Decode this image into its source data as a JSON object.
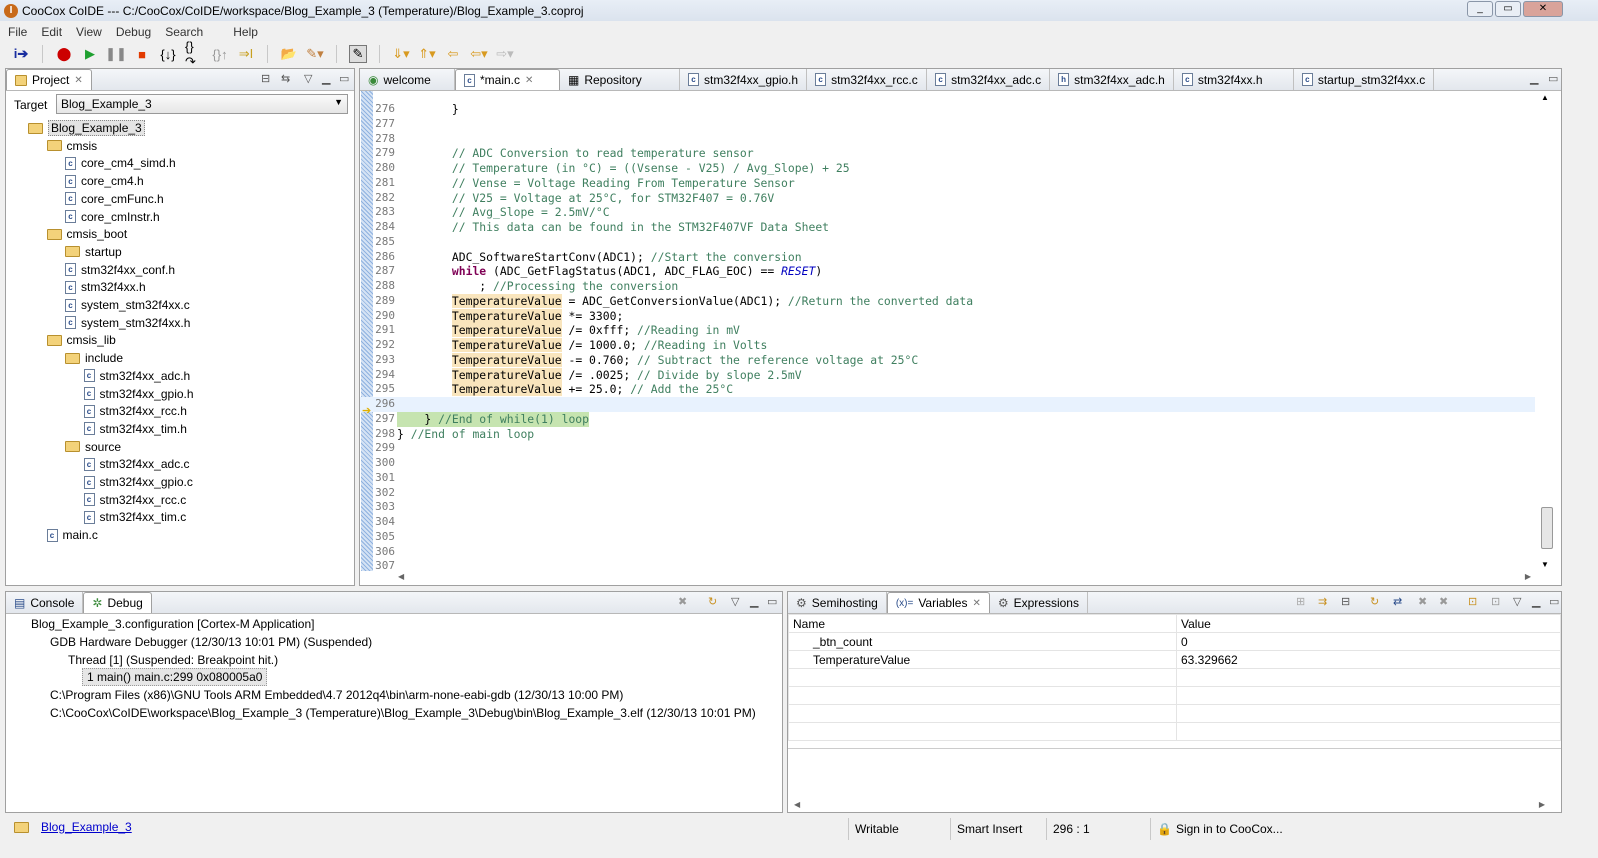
{
  "window": {
    "title": "CooCox CoIDE --- C:/CooCox/CoIDE/workspace/Blog_Example_3 (Temperature)/Blog_Example_3.coproj",
    "app_icon": "I"
  },
  "menu": [
    "File",
    "Edit",
    "View",
    "Debug",
    "Search",
    "Help"
  ],
  "project": {
    "tab_label": "Project",
    "target_label": "Target",
    "target_value": "Blog_Example_3",
    "tree": [
      {
        "label": "Blog_Example_3",
        "level": 0,
        "type": "project"
      },
      {
        "label": "cmsis",
        "level": 1,
        "type": "folder"
      },
      {
        "label": "core_cm4_simd.h",
        "level": 2,
        "type": "file"
      },
      {
        "label": "core_cm4.h",
        "level": 2,
        "type": "file"
      },
      {
        "label": "core_cmFunc.h",
        "level": 2,
        "type": "file"
      },
      {
        "label": "core_cmInstr.h",
        "level": 2,
        "type": "file"
      },
      {
        "label": "cmsis_boot",
        "level": 1,
        "type": "folder"
      },
      {
        "label": "startup",
        "level": 2,
        "type": "folder"
      },
      {
        "label": "stm32f4xx_conf.h",
        "level": 2,
        "type": "file"
      },
      {
        "label": "stm32f4xx.h",
        "level": 2,
        "type": "file"
      },
      {
        "label": "system_stm32f4xx.c",
        "level": 2,
        "type": "file"
      },
      {
        "label": "system_stm32f4xx.h",
        "level": 2,
        "type": "file"
      },
      {
        "label": "cmsis_lib",
        "level": 1,
        "type": "folder"
      },
      {
        "label": "include",
        "level": 2,
        "type": "folder"
      },
      {
        "label": "stm32f4xx_adc.h",
        "level": 3,
        "type": "file"
      },
      {
        "label": "stm32f4xx_gpio.h",
        "level": 3,
        "type": "file"
      },
      {
        "label": "stm32f4xx_rcc.h",
        "level": 3,
        "type": "file"
      },
      {
        "label": "stm32f4xx_tim.h",
        "level": 3,
        "type": "file"
      },
      {
        "label": "source",
        "level": 2,
        "type": "folder"
      },
      {
        "label": "stm32f4xx_adc.c",
        "level": 3,
        "type": "file"
      },
      {
        "label": "stm32f4xx_gpio.c",
        "level": 3,
        "type": "file"
      },
      {
        "label": "stm32f4xx_rcc.c",
        "level": 3,
        "type": "file"
      },
      {
        "label": "stm32f4xx_tim.c",
        "level": 3,
        "type": "file"
      },
      {
        "label": "main.c",
        "level": 1,
        "type": "file"
      }
    ]
  },
  "editor": {
    "tabs": [
      {
        "label": "welcome",
        "icon": "globe"
      },
      {
        "label": "*main.c",
        "icon": "c",
        "active": true
      },
      {
        "label": "Repository",
        "icon": "grid"
      },
      {
        "label": "stm32f4xx_gpio.h",
        "icon": "c"
      },
      {
        "label": "stm32f4xx_rcc.c",
        "icon": "c"
      },
      {
        "label": "stm32f4xx_adc.c",
        "icon": "c"
      },
      {
        "label": "stm32f4xx_adc.h",
        "icon": "h"
      },
      {
        "label": "stm32f4xx.h",
        "icon": "c"
      },
      {
        "label": "startup_stm32f4xx.c",
        "icon": "c"
      }
    ],
    "lines": [
      {
        "n": "276",
        "s": [
          [
            "        }",
            ""
          ]
        ]
      },
      {
        "n": "277",
        "s": []
      },
      {
        "n": "278",
        "s": []
      },
      {
        "n": "279",
        "s": [
          [
            "        // ADC Conversion to read temperature sensor",
            "cm"
          ]
        ]
      },
      {
        "n": "280",
        "s": [
          [
            "        // Temperature (in °C) = ((Vsense - V25) / Avg_Slope) + 25",
            "cm"
          ]
        ]
      },
      {
        "n": "281",
        "s": [
          [
            "        // Vense = Voltage Reading From Temperature Sensor",
            "cm"
          ]
        ]
      },
      {
        "n": "282",
        "s": [
          [
            "        // V25 = Voltage at 25°C, for STM32F407 = 0.76V",
            "cm"
          ]
        ]
      },
      {
        "n": "283",
        "s": [
          [
            "        // Avg_Slope = 2.5mV/°C",
            "cm"
          ]
        ]
      },
      {
        "n": "284",
        "s": [
          [
            "        // This data can be found in the STM32F407VF Data Sheet",
            "cm"
          ]
        ]
      },
      {
        "n": "285",
        "s": []
      },
      {
        "n": "286",
        "s": [
          [
            "        ADC_SoftwareStartConv(ADC1); ",
            ""
          ],
          [
            "//Start the conversion",
            "cm"
          ]
        ]
      },
      {
        "n": "287",
        "s": [
          [
            "        ",
            ""
          ],
          [
            "while",
            "kw"
          ],
          [
            " (ADC_GetFlagStatus(ADC1, ADC_FLAG_EOC) == ",
            ""
          ],
          [
            "RESET",
            "en"
          ],
          [
            ")",
            ""
          ]
        ]
      },
      {
        "n": "288",
        "s": [
          [
            "            ; ",
            ""
          ],
          [
            "//Processing the conversion",
            "cm"
          ]
        ]
      },
      {
        "n": "289",
        "s": [
          [
            "        ",
            ""
          ],
          [
            "TemperatureValue",
            "hl"
          ],
          [
            " = ADC_GetConversionValue(ADC1); ",
            ""
          ],
          [
            "//Return the converted data",
            "cm"
          ]
        ]
      },
      {
        "n": "290",
        "s": [
          [
            "        ",
            ""
          ],
          [
            "TemperatureValue",
            "hl"
          ],
          [
            " *= 3300;",
            ""
          ]
        ]
      },
      {
        "n": "291",
        "s": [
          [
            "        ",
            ""
          ],
          [
            "TemperatureValue",
            "hl"
          ],
          [
            " /= 0xfff; ",
            ""
          ],
          [
            "//Reading in mV",
            "cm"
          ]
        ]
      },
      {
        "n": "292",
        "s": [
          [
            "        ",
            ""
          ],
          [
            "TemperatureValue",
            "hl"
          ],
          [
            " /= 1000.0; ",
            ""
          ],
          [
            "//Reading in Volts",
            "cm"
          ]
        ]
      },
      {
        "n": "293",
        "s": [
          [
            "        ",
            ""
          ],
          [
            "TemperatureValue",
            "hl"
          ],
          [
            " -= 0.760; ",
            ""
          ],
          [
            "// Subtract the reference voltage at 25°C",
            "cm"
          ]
        ]
      },
      {
        "n": "294",
        "s": [
          [
            "        ",
            ""
          ],
          [
            "TemperatureValue",
            "hl"
          ],
          [
            " /= .0025; ",
            ""
          ],
          [
            "// Divide by slope 2.5mV",
            "cm"
          ]
        ]
      },
      {
        "n": "295",
        "s": [
          [
            "        ",
            ""
          ],
          [
            "TemperatureValue",
            "hl"
          ],
          [
            " += 25.0; ",
            ""
          ],
          [
            "// Add the 25°C",
            "cm"
          ]
        ]
      },
      {
        "n": "296",
        "s": [],
        "current": true
      },
      {
        "n": "297",
        "s": [
          [
            "    } ",
            ""
          ],
          [
            "//End of while(1) loop",
            "cm"
          ]
        ],
        "debug": true
      },
      {
        "n": "298",
        "s": [
          [
            "} ",
            ""
          ],
          [
            "//End of main loop",
            "cm"
          ]
        ]
      },
      {
        "n": "299",
        "s": []
      },
      {
        "n": "300",
        "s": []
      },
      {
        "n": "301",
        "s": []
      },
      {
        "n": "302",
        "s": []
      },
      {
        "n": "303",
        "s": []
      },
      {
        "n": "304",
        "s": []
      },
      {
        "n": "305",
        "s": []
      },
      {
        "n": "306",
        "s": []
      },
      {
        "n": "307",
        "s": []
      }
    ]
  },
  "debug_panel": {
    "tabs": [
      "Console",
      "Debug"
    ],
    "items": [
      "Blog_Example_3.configuration [Cortex-M Application]",
      "GDB Hardware Debugger (12/30/13 10:01 PM) (Suspended)",
      "Thread [1] (Suspended: Breakpoint hit.)",
      "1 main() main.c:299 0x080005a0",
      "C:\\Program Files (x86)\\GNU Tools ARM Embedded\\4.7 2012q4\\bin\\arm-none-eabi-gdb (12/30/13 10:00 PM)",
      "C:\\CooCox\\CoIDE\\workspace\\Blog_Example_3 (Temperature)\\Blog_Example_3\\Debug\\bin\\Blog_Example_3.elf (12/30/13 10:01 PM)"
    ]
  },
  "variables_panel": {
    "tabs": [
      "Semihosting",
      "Variables",
      "Expressions"
    ],
    "columns": [
      "Name",
      "Value"
    ],
    "rows": [
      {
        "name": "_btn_count",
        "value": "0"
      },
      {
        "name": "TemperatureValue",
        "value": "63.329662"
      }
    ]
  },
  "statusbar": {
    "project_link": "Blog_Example_3",
    "mode": "Writable",
    "insert": "Smart Insert",
    "position": "296 : 1",
    "signin": "Sign in to CooCox..."
  }
}
